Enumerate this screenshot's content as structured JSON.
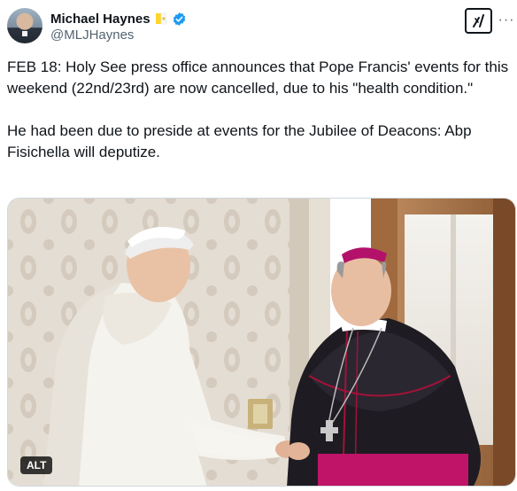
{
  "author": {
    "display_name": "Michael Haynes",
    "handle": "@MLJHaynes",
    "avatar_icon": "avatar-photo",
    "flag_icon": "vatican-flag-icon",
    "verified_icon": "verified-badge-icon",
    "verified_color": "#1d9bf0"
  },
  "actions": {
    "grok_icon": "grok-icon",
    "more_icon": "more-icon",
    "more_label": "···"
  },
  "tweet": {
    "paragraph_1": "FEB 18: Holy See press office announces that Pope Francis' events for this weekend (22nd/23rd) are now cancelled, due to his \"health condition.\"",
    "paragraph_2": "He had been due to preside at events for the Jubilee of Deacons: Abp Fisichella will deputize."
  },
  "media": {
    "alt_label": "ALT",
    "description_icon": "photo-pope-handshake"
  },
  "colors": {
    "text_primary": "#0f1419",
    "text_secondary": "#536471",
    "border": "#cfd9de",
    "accent": "#1d9bf0"
  }
}
